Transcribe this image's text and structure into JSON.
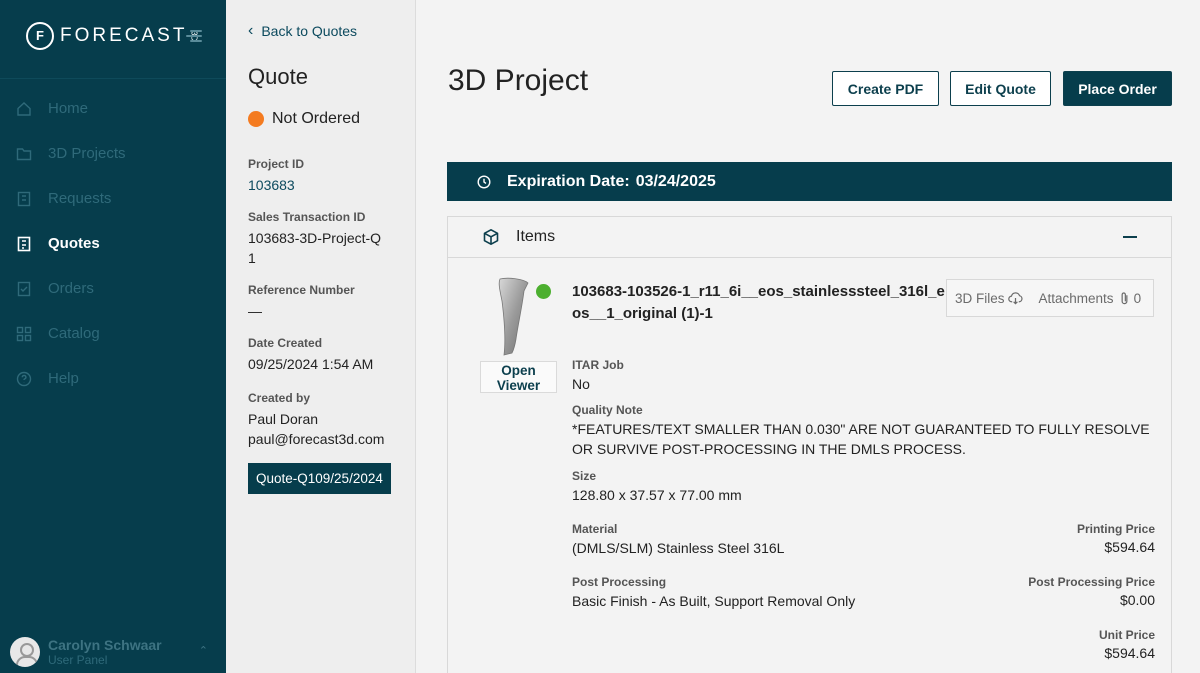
{
  "sidebar": {
    "logo_text": "FORECAST",
    "logo_sup": "3D",
    "items": [
      {
        "label": "Home",
        "icon": "home-icon",
        "active": false
      },
      {
        "label": "3D Projects",
        "icon": "folder-icon",
        "active": false
      },
      {
        "label": "Requests",
        "icon": "requests-icon",
        "active": false
      },
      {
        "label": "Quotes",
        "icon": "quotes-icon",
        "active": true
      },
      {
        "label": "Orders",
        "icon": "orders-icon",
        "active": false
      },
      {
        "label": "Catalog",
        "icon": "catalog-icon",
        "active": false
      },
      {
        "label": "Help",
        "icon": "help-icon",
        "active": false
      }
    ],
    "user": {
      "name": "Carolyn Schwaar",
      "sub": "User Panel"
    }
  },
  "quote_panel": {
    "back_label": "Back to Quotes",
    "title": "Quote",
    "status": "Not Ordered",
    "status_color": "#f47b20",
    "project_id_label": "Project ID",
    "project_id": "103683",
    "sales_txn_label": "Sales Transaction ID",
    "sales_txn": "103683-3D-Project-Q1",
    "reference_label": "Reference Number",
    "reference": "—",
    "date_label": "Date Created",
    "date": "09/25/2024 1:54 AM",
    "created_by_label": "Created by",
    "created_by_name": "Paul Doran",
    "created_by_email": "paul@forecast3d.com",
    "quote_tag": "Quote-Q109/25/2024"
  },
  "main": {
    "title": "3D Project",
    "buttons": {
      "pdf": "Create PDF",
      "edit": "Edit Quote",
      "order": "Place Order"
    },
    "expiration_label": "Expiration Date:",
    "expiration_date": "03/24/2025",
    "items_title": "Items",
    "item": {
      "open_viewer": "Open Viewer",
      "name": "103683-103526-1_r11_6i__eos_stainlesssteel_316l_eos__1_original (1)-1",
      "files_label": "3D Files",
      "attachments_label": "Attachments",
      "attachments_count": "0",
      "itar_label": "ITAR Job",
      "itar": "No",
      "quality_label": "Quality Note",
      "quality": "*FEATURES/TEXT SMALLER THAN 0.030\" ARE NOT GUARANTEED TO FULLY RESOLVE OR SURVIVE POST-PROCESSING IN THE DMLS PROCESS.",
      "size_label": "Size",
      "size": "128.80 x 37.57 x 77.00 mm",
      "material_label": "Material",
      "material": "(DMLS/SLM) Stainless Steel 316L",
      "post_label": "Post Processing",
      "post": "Basic Finish - As Built, Support Removal Only",
      "printing_price_label": "Printing Price",
      "printing_price": "$594.64",
      "post_price_label": "Post Processing Price",
      "post_price": "$0.00",
      "unit_price_label": "Unit Price",
      "unit_price": "$594.64"
    }
  }
}
